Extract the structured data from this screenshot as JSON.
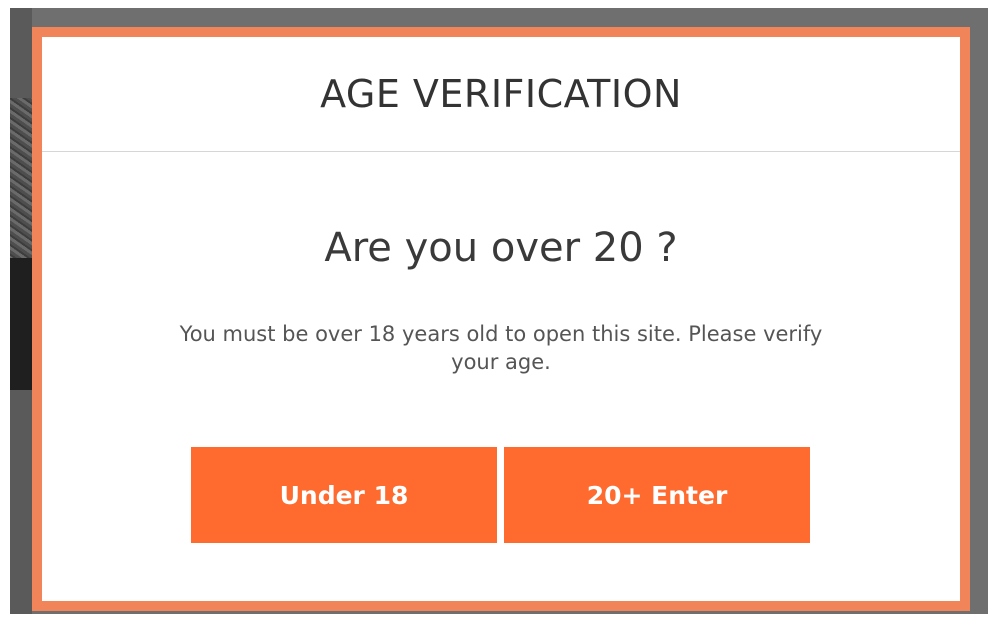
{
  "modal": {
    "title": "AGE VERIFICATION",
    "question": "Are you over 20 ?",
    "message": "You must be over 18 years old to open this site. Please verify your age.",
    "buttons": {
      "under_label": "Under 18",
      "enter_label": "20+ Enter"
    }
  },
  "colors": {
    "modal_border": "#f2845a",
    "button_bg": "#ff6a2f",
    "overlay": "#6f6f6f"
  }
}
